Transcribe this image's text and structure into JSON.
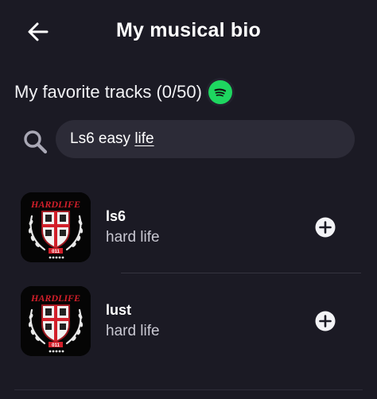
{
  "header": {
    "title": "My musical bio",
    "back_icon": "arrow-left-icon"
  },
  "favorites": {
    "title": "My favorite tracks (0/50)",
    "service_icon": "spotify-icon"
  },
  "search": {
    "icon": "search-icon",
    "value_part1": "Ls6 easy",
    "value_part2": "life"
  },
  "tracks": [
    {
      "name": "ls6",
      "artist": "hard life",
      "cover_text": "HARDLIFE",
      "cover_sub": "011",
      "action_icon": "plus-circle-icon"
    },
    {
      "name": "lust",
      "artist": "hard life",
      "cover_text": "HARDLIFE",
      "cover_sub": "011",
      "action_icon": "plus-circle-icon"
    }
  ],
  "colors": {
    "background": "#1b1a24",
    "input": "#2c2b37",
    "spotify": "#1ed760",
    "cover_accent": "#d21f2a"
  }
}
